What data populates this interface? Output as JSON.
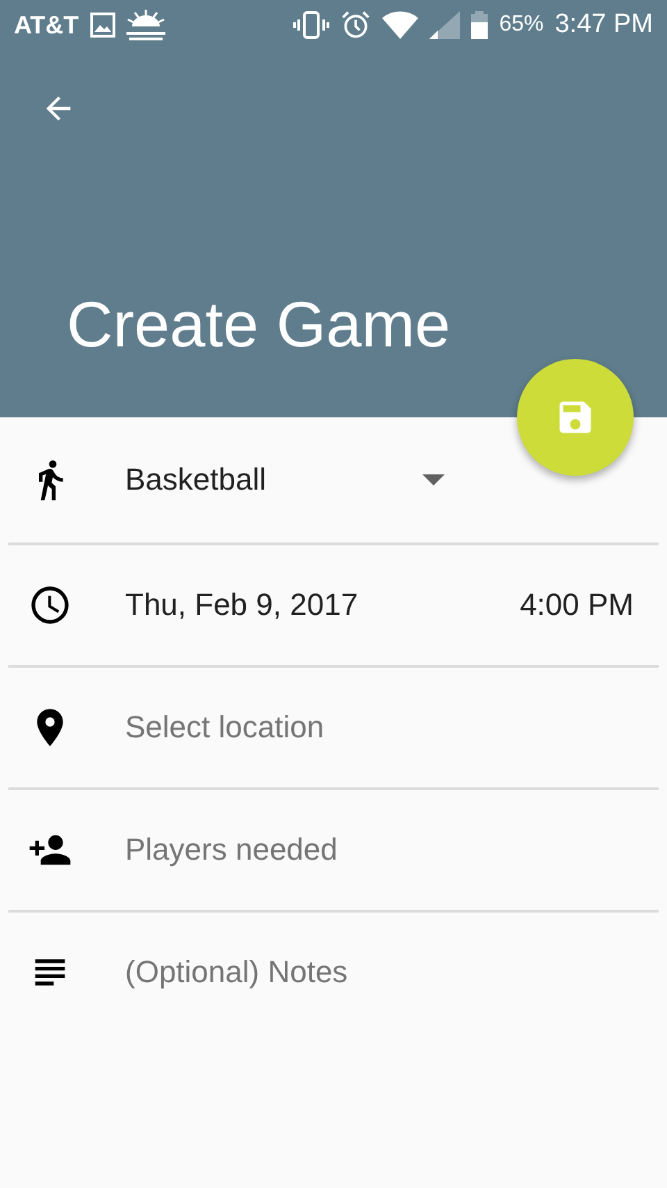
{
  "status_bar": {
    "carrier": "AT&T",
    "battery": "65%",
    "time": "3:47 PM"
  },
  "header": {
    "title": "Create Game"
  },
  "form": {
    "rows": [
      {
        "kind": "dropdown",
        "value": "Basketball"
      },
      {
        "kind": "datetime",
        "date": "Thu, Feb 9, 2017",
        "time": "4:00 PM"
      },
      {
        "kind": "field",
        "placeholder": "Select location"
      },
      {
        "kind": "field",
        "placeholder": "Players needed"
      },
      {
        "kind": "field",
        "placeholder": "(Optional) Notes"
      }
    ]
  }
}
